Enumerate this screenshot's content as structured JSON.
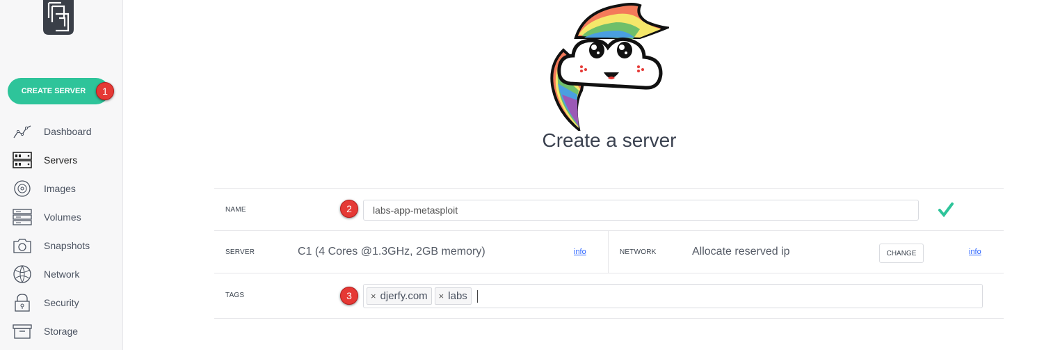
{
  "sidebar": {
    "create_button": "CREATE SERVER",
    "items": [
      {
        "label": "Dashboard",
        "icon": "chart-line-icon"
      },
      {
        "label": "Servers",
        "icon": "server-icon"
      },
      {
        "label": "Images",
        "icon": "disc-icon"
      },
      {
        "label": "Volumes",
        "icon": "volumes-icon"
      },
      {
        "label": "Snapshots",
        "icon": "camera-icon"
      },
      {
        "label": "Network",
        "icon": "globe-icon"
      },
      {
        "label": "Security",
        "icon": "lock-icon"
      },
      {
        "label": "Storage",
        "icon": "archive-box-icon"
      }
    ],
    "active_item": "Servers"
  },
  "annotations": {
    "step1": "1",
    "step2": "2",
    "step3": "3"
  },
  "main": {
    "title": "Create a server",
    "form": {
      "name_label": "NAME",
      "name_value": "labs-app-metasploit",
      "server_label": "SERVER",
      "server_value": "C1 (4 Cores @1.3GHz, 2GB memory)",
      "server_info": "info",
      "network_label": "NETWORK",
      "network_value": "Allocate reserved ip",
      "network_change": "CHANGE",
      "network_info": "info",
      "tags_label": "TAGS",
      "tags": [
        "djerfy.com",
        "labs"
      ]
    }
  },
  "colors": {
    "accent": "#2ec49a",
    "badge": "#e53935",
    "link": "#2962ff"
  }
}
